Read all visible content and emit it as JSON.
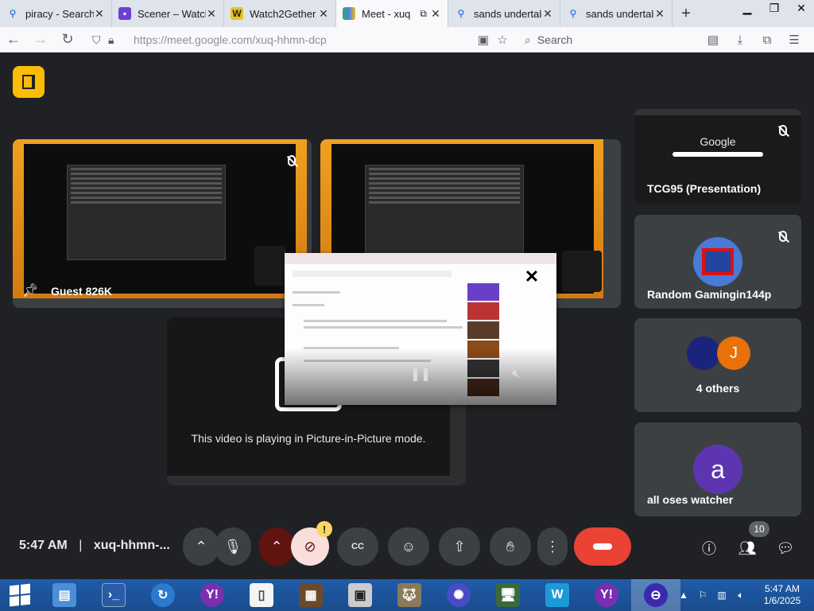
{
  "browser": {
    "tabs": [
      {
        "label": "piracy - Search",
        "icon": "search-icon",
        "color": "#0060df"
      },
      {
        "label": "Scener – Watch",
        "icon": "scener-icon",
        "color": "#6b3fd6"
      },
      {
        "label": "Watch2Gether",
        "icon": "w2g-icon",
        "color": "#e8c41a"
      },
      {
        "label": "Meet - xuq",
        "icon": "meet-icon",
        "color": "#34a853"
      },
      {
        "label": "sands undertale",
        "icon": "search-icon",
        "color": "#0060df"
      },
      {
        "label": "sands undertale",
        "icon": "search-icon",
        "color": "#0060df"
      }
    ],
    "url": "https://meet.google.com/xuq-hhmn-dcp",
    "search_placeholder": "Search"
  },
  "meet": {
    "tiles": [
      {
        "name": "Guest 826K",
        "pinned": true
      },
      {
        "name": "TCG95 (Presentation)",
        "muted": true
      },
      {
        "name": "Random Gamingin144p",
        "muted": true
      },
      {
        "name": "4 others",
        "avatar_letter": "J"
      },
      {
        "name": "all oses watcher",
        "avatar_letter": "a"
      }
    ],
    "pip_message": "This video is playing in Picture-in-Picture mode.",
    "google_label": "Google"
  },
  "bottombar": {
    "time": "5:47 AM",
    "separator": "|",
    "meeting_code": "xuq-hhmn-...",
    "warning": "!",
    "participant_count": "10"
  },
  "taskbar": {
    "time": "5:47 AM",
    "date": "1/6/2025"
  },
  "colors": {
    "meet_bg": "#202124",
    "hangup": "#ea4335",
    "logo": "#fbbc04"
  }
}
